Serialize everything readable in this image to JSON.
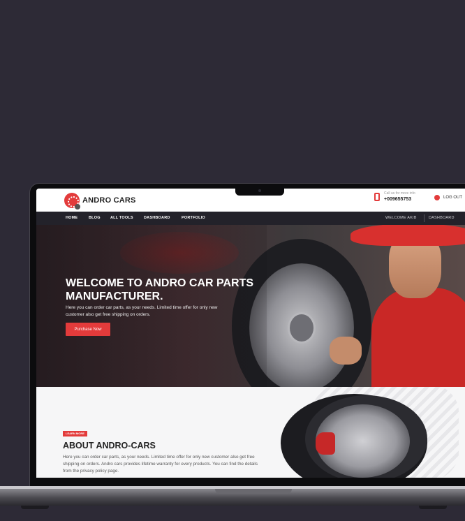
{
  "site": {
    "brand": "ANDRO CARS",
    "call_label": "Call us for more info",
    "phone": "+009655753",
    "logout_label": "LOG OUT"
  },
  "nav": {
    "items": [
      {
        "label": "HOME"
      },
      {
        "label": "BLOG"
      },
      {
        "label": "ALL TOOLS"
      },
      {
        "label": "DASHBOARD"
      },
      {
        "label": "PORTFOLIO"
      }
    ],
    "welcome": "WELCOME AKIB",
    "dashboard_right": "DASHBOARD"
  },
  "hero": {
    "title": "WELCOME TO ANDRO CAR PARTS MANUFACTURER.",
    "text": "Here you can order car parts, as your needs. Limited time offer for only new customer also get free shipping on orders.",
    "button": "Purchase Now"
  },
  "about": {
    "badge": "LEARN MORE",
    "title": "ABOUT ANDRO-CARS",
    "text": "Here you can order car parts, as your needs. Limited time offer for only new customer also get free shipping on orders. Andro cars provides lifetime warranty for every products. You can find the details from the privacy policy page."
  },
  "colors": {
    "accent": "#e33b3b",
    "nav_bg": "#23222a",
    "page_bg": "#2d2a36"
  }
}
